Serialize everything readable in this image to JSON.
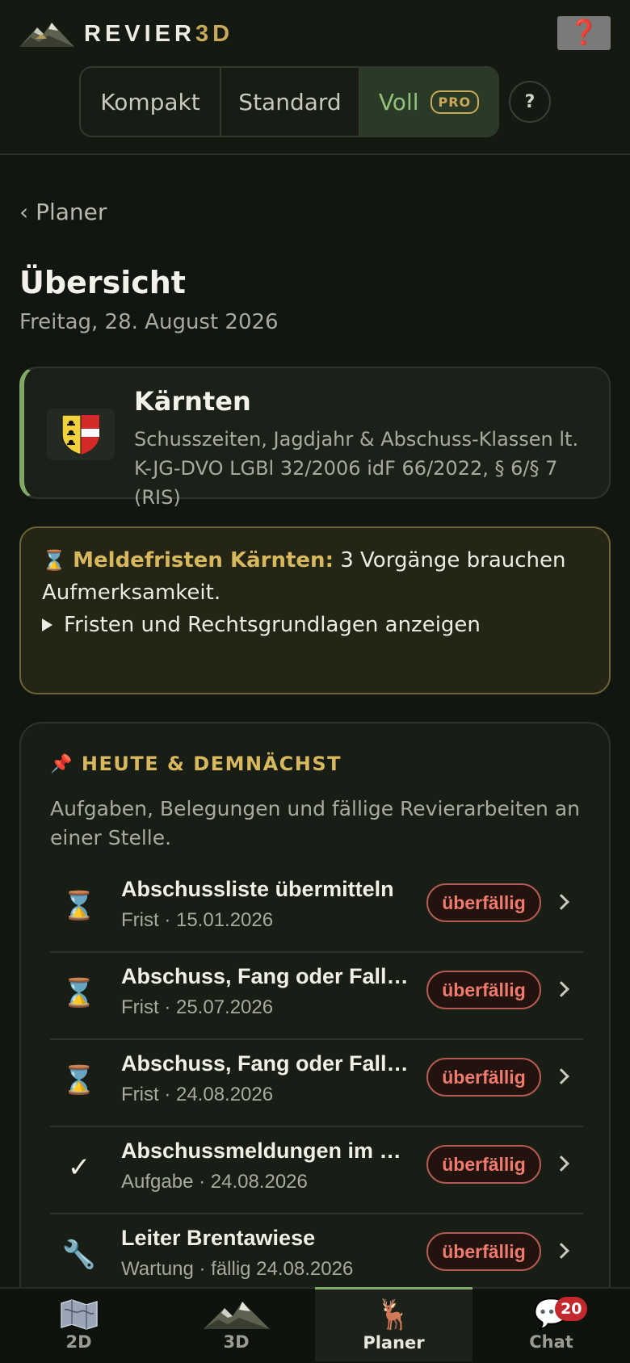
{
  "header": {
    "brand_main": "REVIER",
    "brand_accent": "3D",
    "help_glyph": "❓",
    "modes": [
      {
        "label": "Kompakt"
      },
      {
        "label": "Standard"
      },
      {
        "label": "Voll",
        "badge": "PRO",
        "active": true
      }
    ],
    "mode_help": "?"
  },
  "content": {
    "back_label": "‹ Planer",
    "title": "Übersicht",
    "date": "Freitag, 28. August 2026",
    "state": {
      "name": "Kärnten",
      "description": "Schusszeiten, Jagdjahr & Abschuss-Klassen lt. K-JG-DVO LGBl 32/2006 idF 66/2022, § 6/§ 7 (RIS)"
    },
    "deadlines": {
      "icon": "⌛",
      "highlight": "Meldefristen Kärnten:",
      "text": " 3 Vorgänge brauchen Aufmerksamkeit.",
      "toggle_label": "Fristen und Rechtsgrundlagen anzeigen"
    },
    "today": {
      "icon": "📌",
      "heading": "HEUTE & DEMNÄCHST",
      "description": "Aufgaben, Belegungen und fällige Revierarbeiten an einer Stelle.",
      "tasks": [
        {
          "icon": "hourglass-icon",
          "glyph": "⌛",
          "title": "Abschussliste übermitteln",
          "sub": "Frist · 15.01.2026",
          "status": "überfällig"
        },
        {
          "icon": "hourglass-icon",
          "glyph": "⌛",
          "title": "Abschuss, Fang oder Fallwild melden",
          "sub": "Frist · 25.07.2026",
          "status": "überfällig"
        },
        {
          "icon": "hourglass-icon",
          "glyph": "⌛",
          "title": "Abschuss, Fang oder Fallwild melden",
          "sub": "Frist · 24.08.2026",
          "status": "überfällig"
        },
        {
          "icon": "check-icon",
          "glyph": "✓",
          "title": "Abschussmeldungen im Jagdjahr",
          "sub": "Aufgabe · 24.08.2026",
          "status": "überfällig"
        },
        {
          "icon": "wrench-icon",
          "glyph": "🔧",
          "title": "Leiter Brentawiese",
          "sub": "Wartung · fällig 24.08.2026",
          "status": "überfällig"
        }
      ]
    }
  },
  "nav": {
    "items": [
      {
        "label": "2D",
        "icon": "map-icon"
      },
      {
        "label": "3D",
        "icon": "mountain-icon"
      },
      {
        "label": "Planer",
        "icon": "deer-icon",
        "glyph": "🦌",
        "active": true
      },
      {
        "label": "Chat",
        "icon": "chat-icon",
        "glyph": "💬",
        "badge": "20"
      }
    ]
  },
  "colors": {
    "accent_gold": "#c9a95a",
    "accent_green": "#7fa867",
    "status_red": "#f07a6e",
    "background": "#121610"
  }
}
